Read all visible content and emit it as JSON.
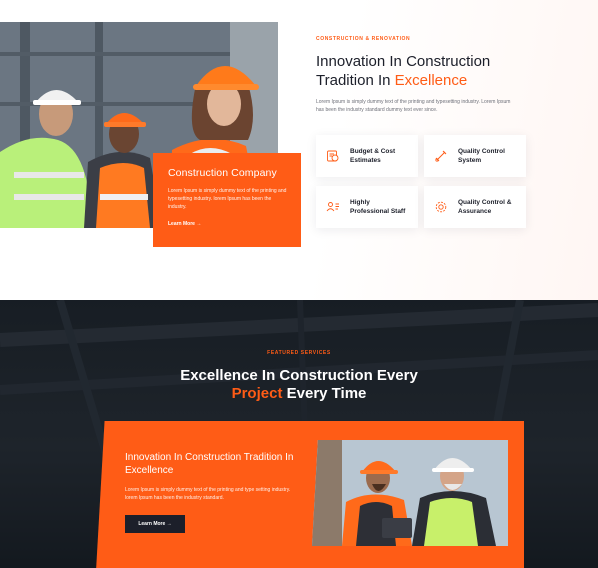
{
  "about": {
    "eyebrow": "CONSTRUCTION & RENOVATION",
    "headline_part1": "Innovation In Construction",
    "headline_part2": "Tradition In",
    "headline_accent": "Excellence",
    "intro": "Lorem Ipsum is simply dummy text of the printing and typesetting industry. Lorem Ipsum has been the industry standard dummy text ever since.",
    "card": {
      "title": "Construction Company",
      "text": "Lorem Ipsum is simply dummy text of the printing and typesetting industry. lorem Ipsum has been the industry.",
      "link": "Learn More →"
    },
    "features": [
      {
        "label": "Budget & Cost Estimates",
        "icon": "budget-icon"
      },
      {
        "label": "Quality Control System",
        "icon": "tools-icon"
      },
      {
        "label": "Highly Professional Staff",
        "icon": "staff-icon"
      },
      {
        "label": "Quality Control & Assurance",
        "icon": "gear-icon"
      }
    ]
  },
  "services": {
    "eyebrow": "FEATURED SERVICES",
    "headline_part1": "Excellence In Construction Every",
    "headline_accent": "Project",
    "headline_part2": "Every Time",
    "panel": {
      "title": "Innovation In Construction Tradition In Excellence",
      "text": "Lorem Ipsum is simply dummy text of the printing and type setting industry. lorem Ipsum has been the industry standard.",
      "button": "Learn More →"
    }
  },
  "colors": {
    "accent": "#ff5c16",
    "dark": "#1c1f2a"
  }
}
